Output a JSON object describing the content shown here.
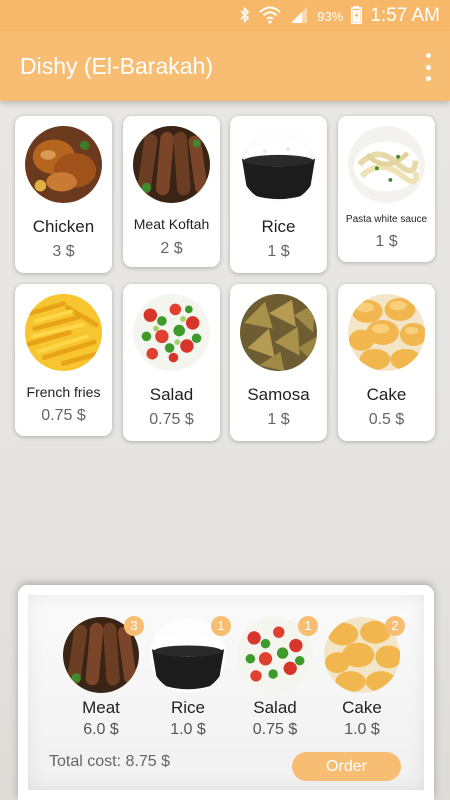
{
  "status_bar": {
    "battery": "93%",
    "time": "1:57 AM"
  },
  "app_bar": {
    "title": "Dishy (El-Barakah)"
  },
  "menu": [
    {
      "name": "Chicken",
      "price": "3 $"
    },
    {
      "name": "Meat Koftah",
      "price": "2 $"
    },
    {
      "name": "Rice",
      "price": "1 $"
    },
    {
      "name": "Pasta white sauce",
      "price": "1 $"
    },
    {
      "name": "French fries",
      "price": "0.75 $"
    },
    {
      "name": "Salad",
      "price": "0.75 $"
    },
    {
      "name": "Samosa",
      "price": "1 $"
    },
    {
      "name": "Cake",
      "price": "0.5 $"
    }
  ],
  "order": {
    "items": [
      {
        "name": "Meat",
        "price": "6.0 $",
        "count": "3"
      },
      {
        "name": "Rice",
        "price": "1.0 $",
        "count": "1"
      },
      {
        "name": "Salad",
        "price": "0.75 $",
        "count": "1"
      },
      {
        "name": "Cake",
        "price": "1.0 $",
        "count": "2"
      }
    ],
    "total": "Total cost: 8.75 $",
    "order_label": "Order"
  },
  "colors": {
    "accent": "#f7bd72",
    "status_bar": "#f7b86a"
  }
}
